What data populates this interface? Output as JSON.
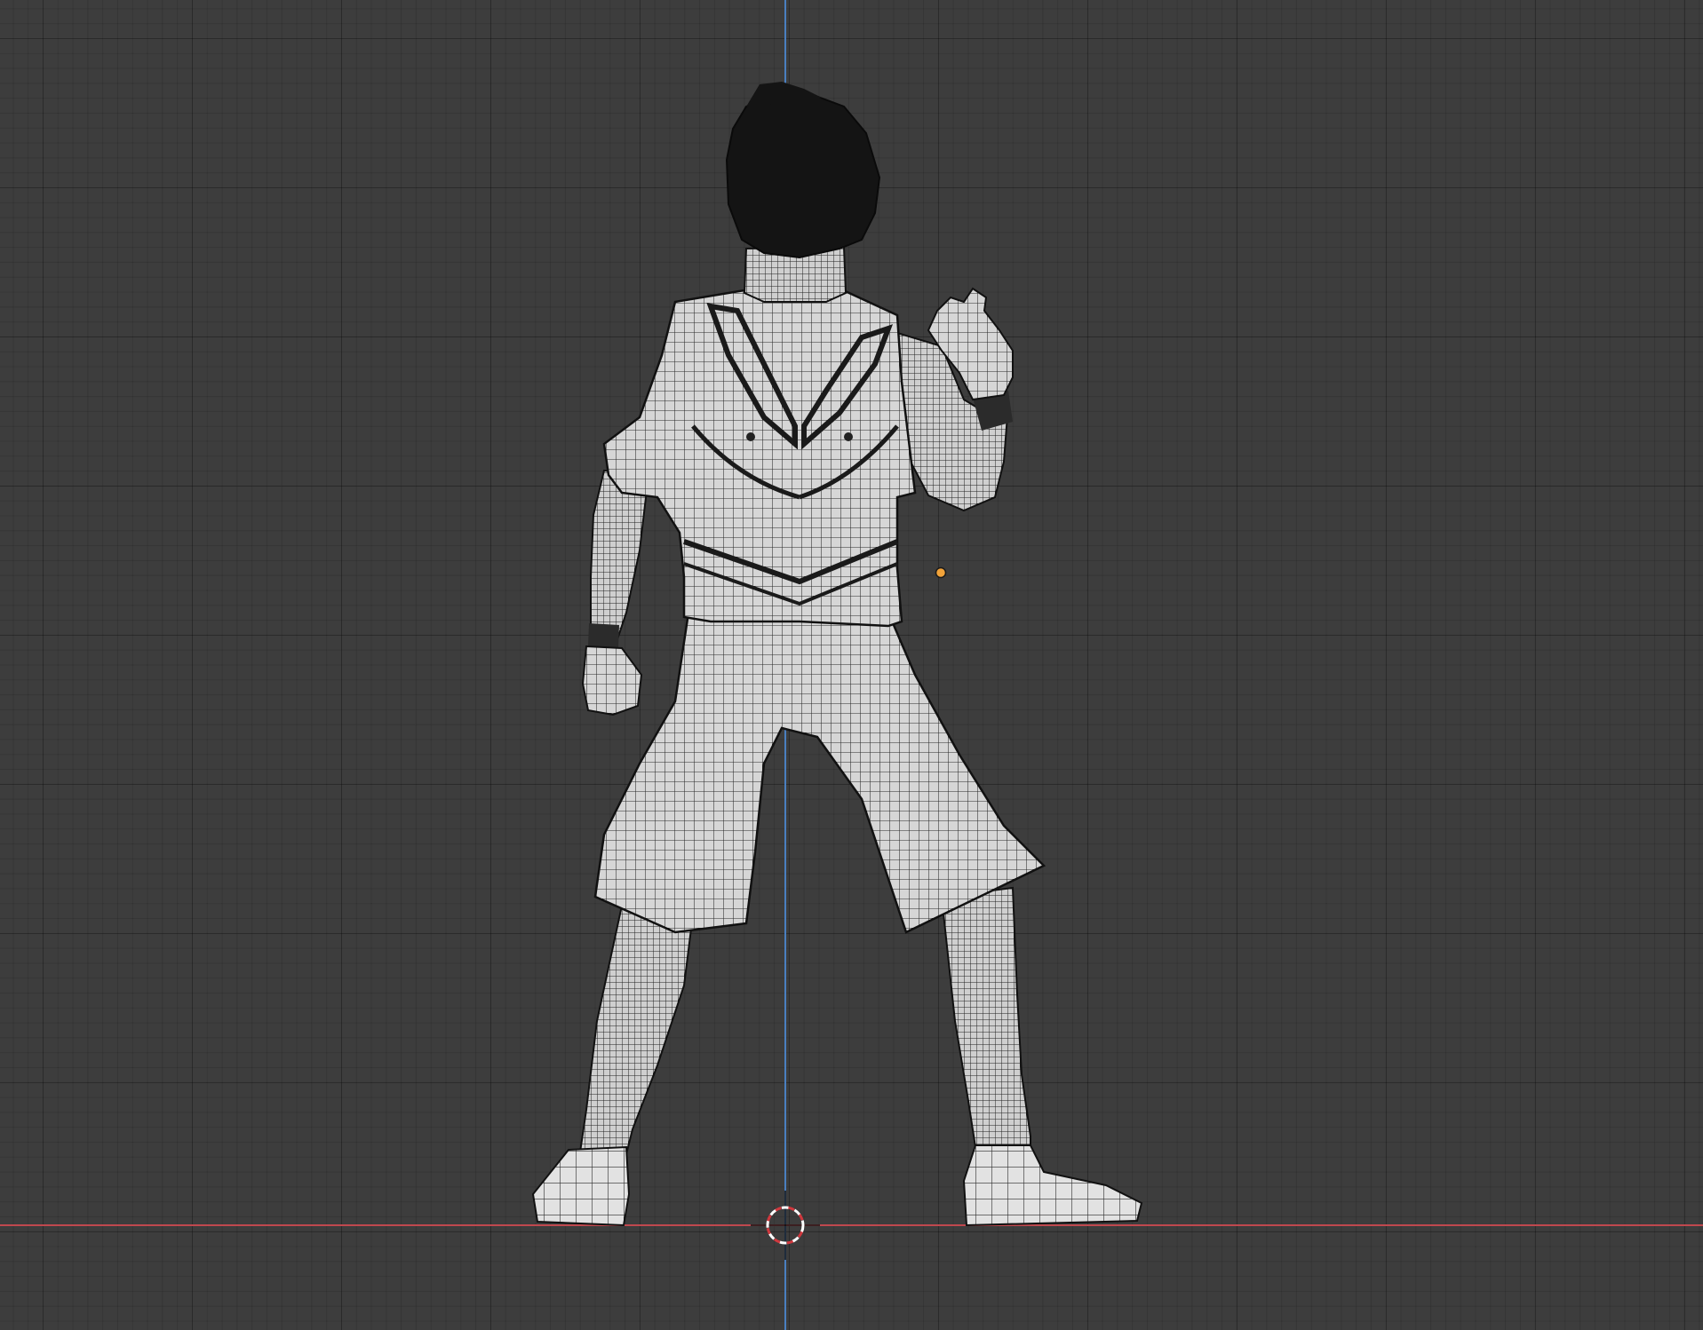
{
  "viewport": {
    "view": "back-orthographic",
    "shading": "solid-wireframe",
    "colors": {
      "background": "#3d3d3d",
      "grid_line": "#333333",
      "axis_x": "#c0484e",
      "axis_z": "#4a7fc0",
      "mesh_fill": "#d8d8d8",
      "wire": "#1e1e1e",
      "hair": "#141414",
      "origin": "#f2a33a"
    }
  },
  "objects": [
    {
      "name_icon": "character-mesh",
      "selected": false
    },
    {
      "name_icon": "object-origin-dot",
      "selected": true
    },
    {
      "name_icon": "3d-cursor-icon",
      "selected": false
    }
  ]
}
